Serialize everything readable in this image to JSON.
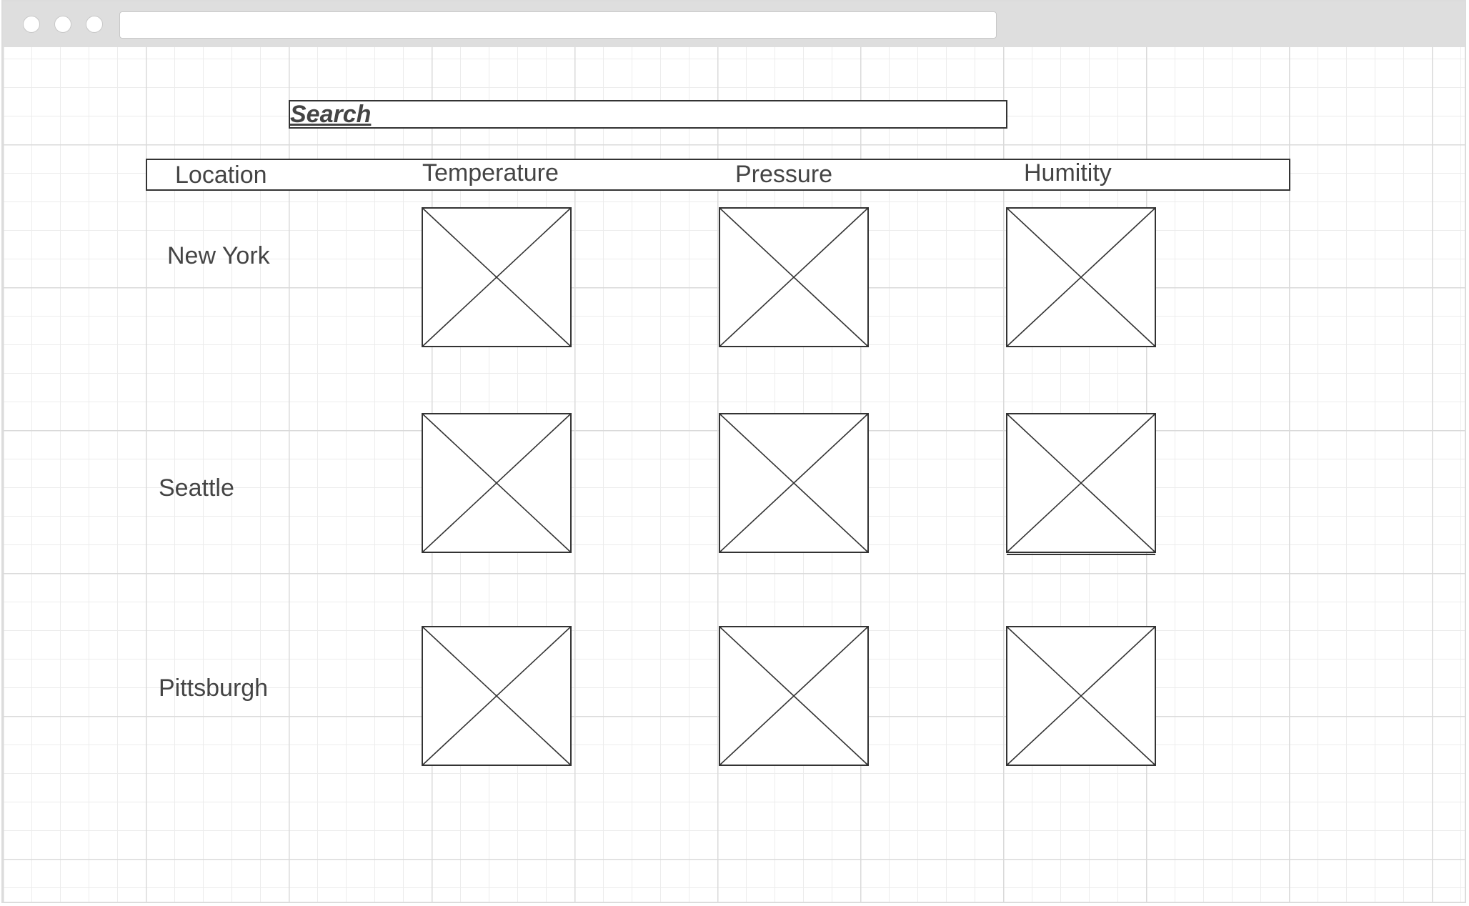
{
  "search": {
    "label": "Search"
  },
  "table": {
    "columns": [
      "Location",
      "Temperature",
      "Pressure",
      "Humitity"
    ],
    "rows": [
      {
        "location": "New York"
      },
      {
        "location": "Seattle"
      },
      {
        "location": "Pittsburgh"
      }
    ]
  },
  "icons": {
    "placeholder": "image-placeholder-icon"
  },
  "colors": {
    "chrome": "#dedede",
    "stroke": "#333333",
    "text": "#444444"
  }
}
